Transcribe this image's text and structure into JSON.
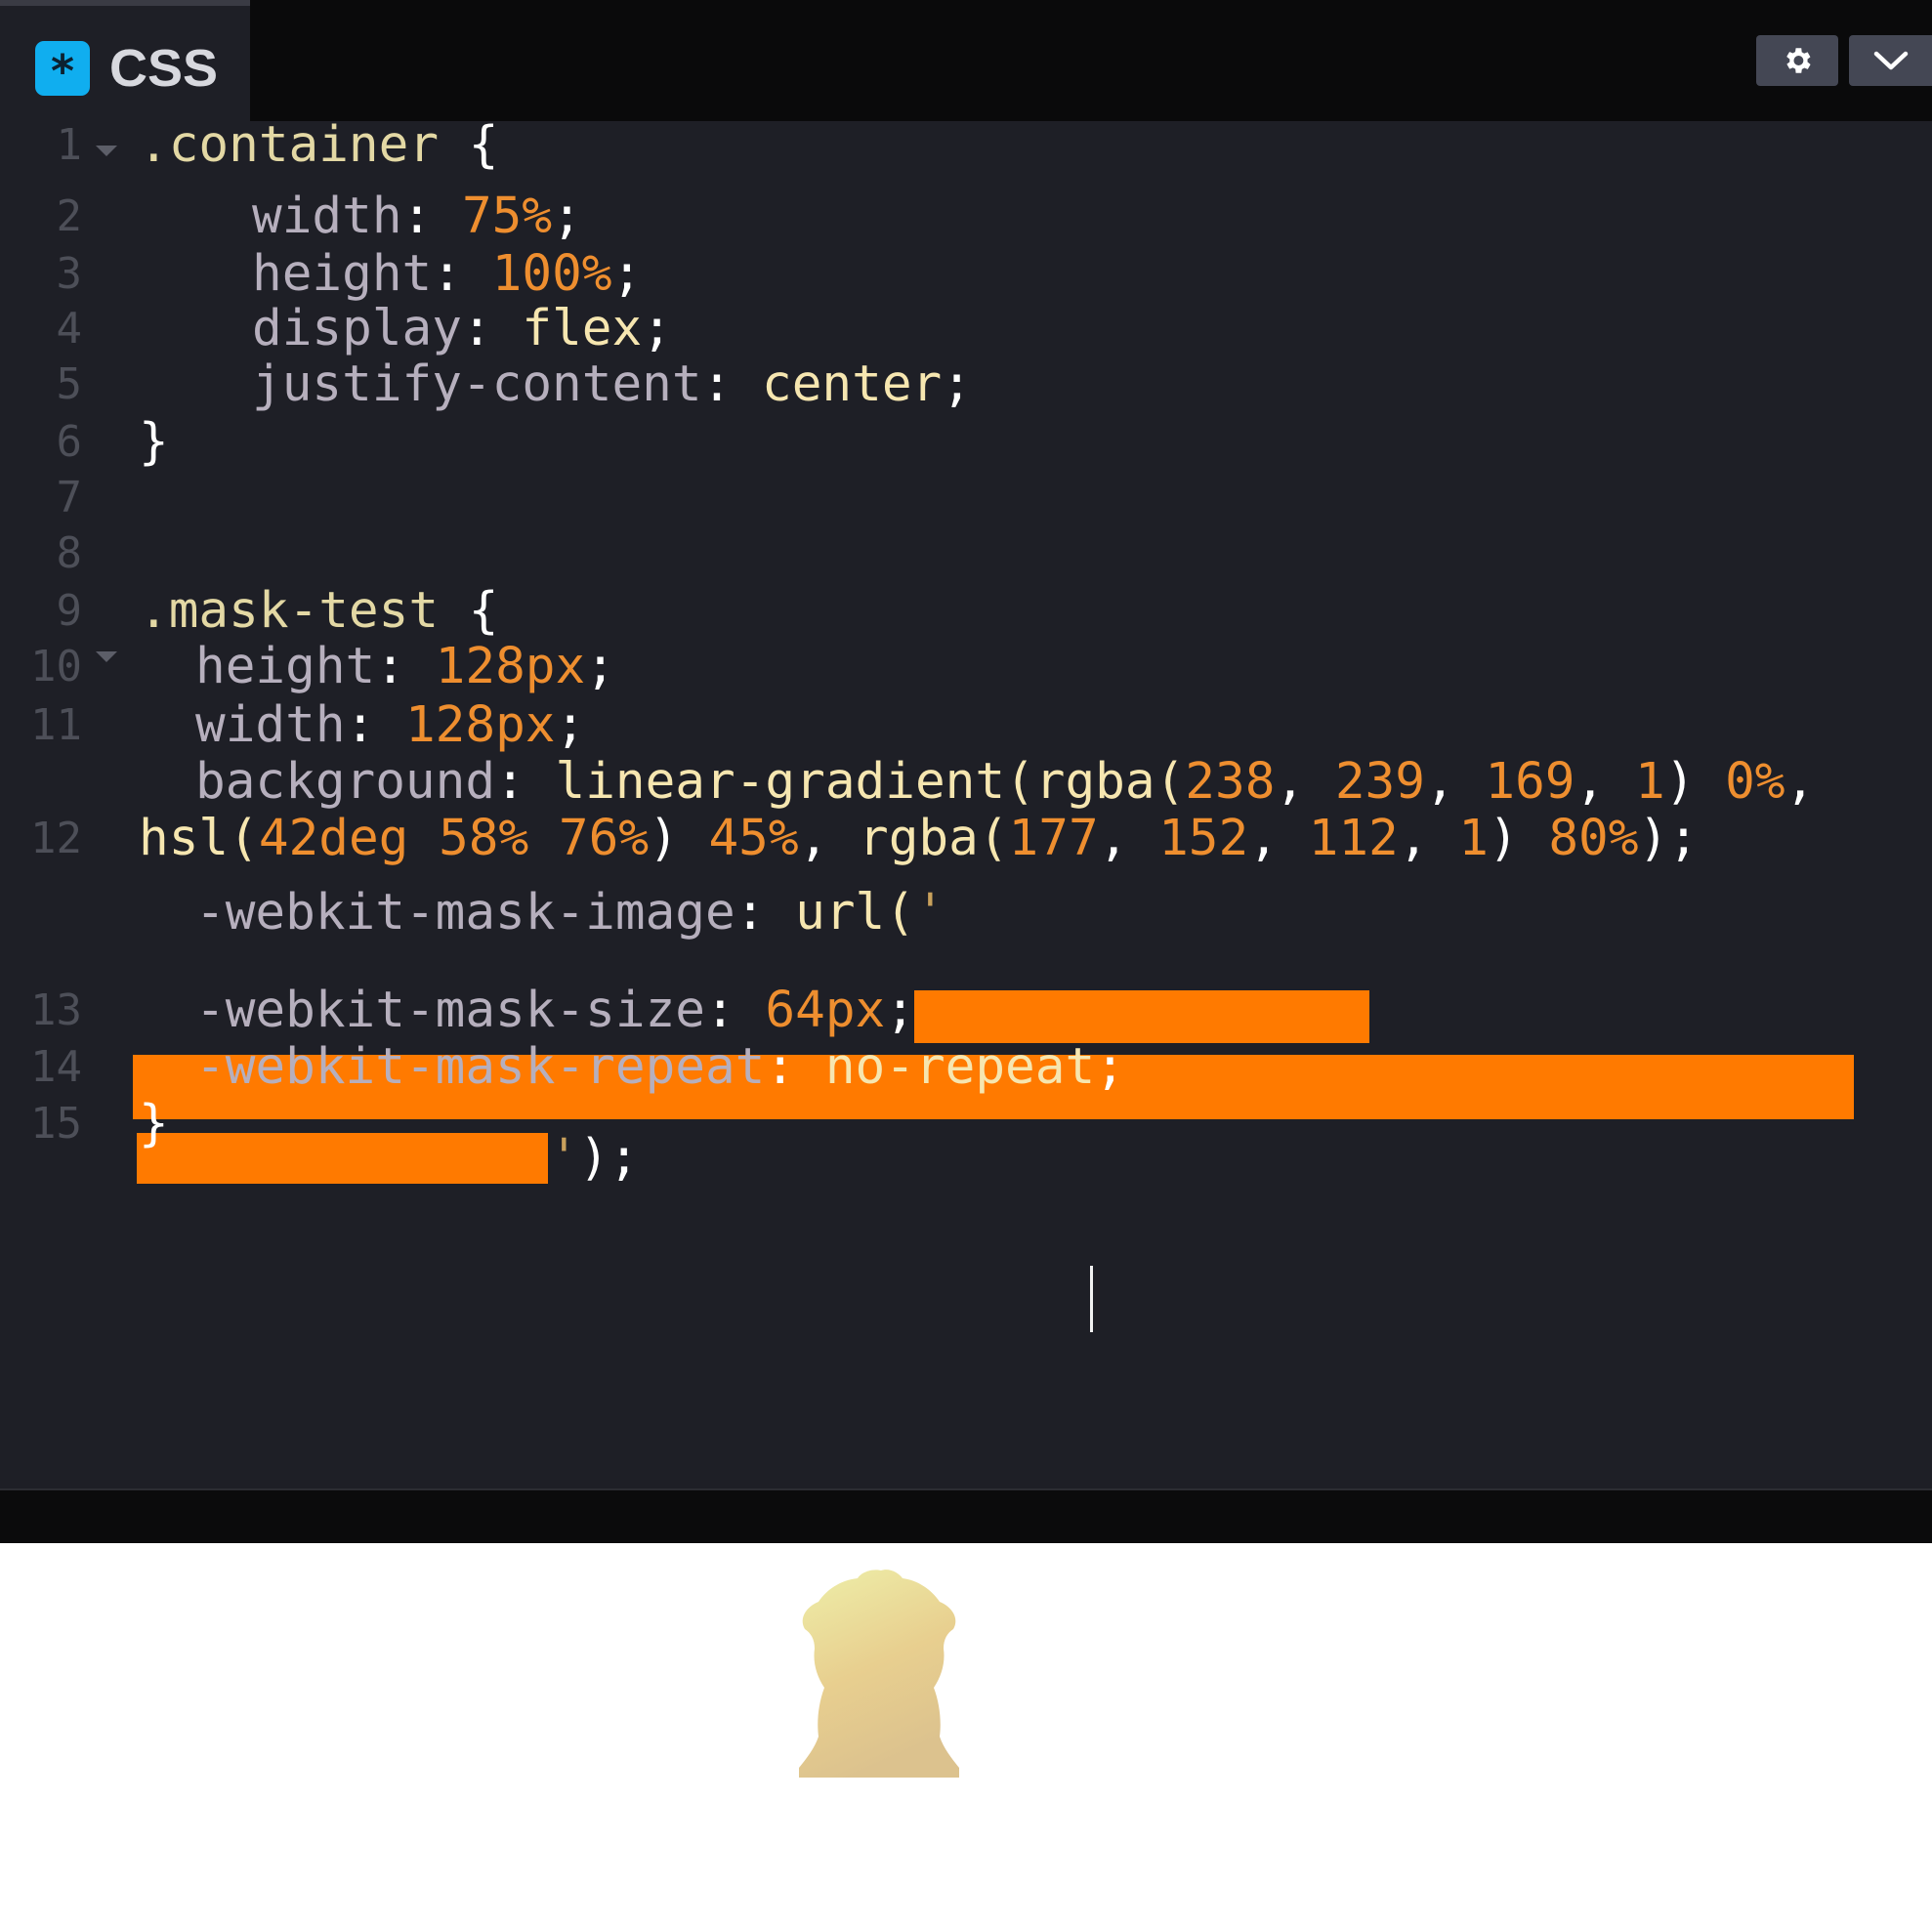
{
  "tab": {
    "icon": "asterisk-icon",
    "label": "CSS"
  },
  "toolbar": {
    "settings_icon": "gear-icon",
    "collapse_icon": "chevron-down-icon"
  },
  "line_numbers": [
    "1",
    "2",
    "3",
    "4",
    "5",
    "6",
    "7",
    "8",
    "9",
    "10",
    "11",
    "12",
    "13",
    "14",
    "15"
  ],
  "code": {
    "l1": {
      "selector": ".container",
      "brace": "{"
    },
    "l2": {
      "prop": "width",
      "colon": ":",
      "value": "75%",
      "semi": ";"
    },
    "l3": {
      "prop": "height",
      "colon": ":",
      "value": "100%",
      "semi": ";"
    },
    "l4": {
      "prop": "display",
      "colon": ":",
      "value": "flex",
      "semi": ";"
    },
    "l5": {
      "prop": "justify-content",
      "colon": ":",
      "value": "center",
      "semi": ";"
    },
    "l6": {
      "brace": "}"
    },
    "l8": {
      "selector": ".mask-test",
      "brace": "{"
    },
    "l9": {
      "prop": "height",
      "colon": ":",
      "value": "128px",
      "semi": ";"
    },
    "l10": {
      "prop": "width",
      "colon": ":",
      "value": "128px",
      "semi": ";"
    },
    "l11": {
      "prop": "background",
      "colon": ":",
      "fn1": "linear-gradient(",
      "fn2": "rgba(",
      "n1": "238",
      "c1": ", ",
      "n2": "239",
      "c2": ", ",
      "n3": "169",
      "c3": ", ",
      "n4": "1",
      "p1": ") ",
      "n5": "0%",
      "c4": ",",
      "fn3": "hsl(",
      "n6": "42deg",
      "s1": " ",
      "n7": "58%",
      "s2": " ",
      "n8": "76%",
      "p2": ") ",
      "n9": "45%",
      "c5": ", ",
      "fn4": "rgba(",
      "n10": "177",
      "c6": ", ",
      "n11": "152",
      "c7": ", ",
      "n12": "112",
      "c8": ", ",
      "n13": "1",
      "p3": ") ",
      "n14": "80%",
      "end": ");"
    },
    "l12": {
      "prop": "-webkit-mask-image",
      "colon": ":",
      "fn": "url(",
      "quote_open": "'",
      "quote_close": "'",
      "end": ");"
    },
    "l13": {
      "prop": "-webkit-mask-size",
      "colon": ":",
      "value": "64px",
      "semi": ";"
    },
    "l14": {
      "prop": "-webkit-mask-repeat",
      "colon": ":",
      "value": "no-repeat",
      "semi": ";"
    },
    "l15": {
      "brace": "}"
    }
  },
  "colors": {
    "editor_bg": "#1e1f26",
    "redaction": "#ff7a00",
    "gradient": [
      "#eeefa9",
      "#e8cf8f",
      "#b19870"
    ]
  }
}
